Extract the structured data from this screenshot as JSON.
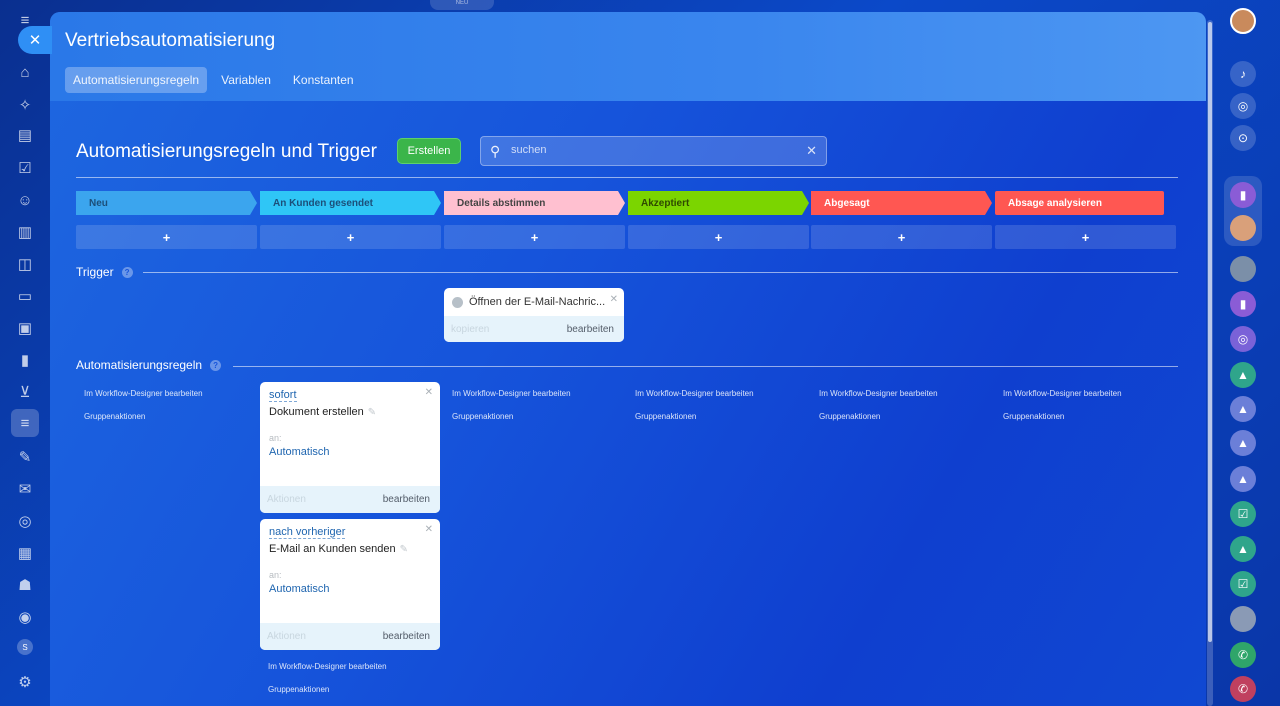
{
  "panel": {
    "title": "Vertriebsautomatisierung",
    "tabs": [
      {
        "label": "Automatisierungsregeln",
        "active": true
      },
      {
        "label": "Variablen",
        "active": false
      },
      {
        "label": "Konstanten",
        "active": false
      }
    ]
  },
  "top_pill": "NEU",
  "rail_user_initial": "S",
  "toolbar": {
    "title": "Automatisierungsregeln und Trigger",
    "create_label": "Erstellen",
    "search_placeholder": "suchen"
  },
  "stages": [
    {
      "label": "Neu",
      "color": "#3ba5ee",
      "text_color": "#1c4f7a"
    },
    {
      "label": "An Kunden gesendet",
      "color": "#2fc6f6",
      "text_color": "#1c4f7a"
    },
    {
      "label": "Details abstimmen",
      "color": "#ffc0d0",
      "text_color": "#444444"
    },
    {
      "label": "Akzeptiert",
      "color": "#7bd500",
      "text_color": "#2f4a00"
    },
    {
      "label": "Abgesagt",
      "color": "#ff5752",
      "text_color": "#ffffff"
    },
    {
      "label": "Absage analysieren",
      "color": "#ff5752",
      "text_color": "#ffffff"
    }
  ],
  "add_symbol": "+",
  "trigger_section": {
    "label": "Trigger",
    "card": {
      "title": "Öffnen der E-Mail-Nachric...",
      "copy_label": "kopieren",
      "edit_label": "bearbeiten"
    }
  },
  "rules_section": {
    "label": "Automatisierungsregeln",
    "designer_link": "Im Workflow-Designer bearbeiten",
    "group_actions": "Gruppenaktionen",
    "cards": [
      {
        "when": "sofort",
        "title": "Dokument erstellen",
        "an_label": "an:",
        "responsible": "Automatisch",
        "actions_label": "Aktionen",
        "edit_label": "bearbeiten"
      },
      {
        "when": "nach vorheriger",
        "title": "E-Mail an Kunden senden",
        "an_label": "an:",
        "responsible": "Automatisch",
        "actions_label": "Aktionen",
        "edit_label": "bearbeiten"
      }
    ]
  }
}
